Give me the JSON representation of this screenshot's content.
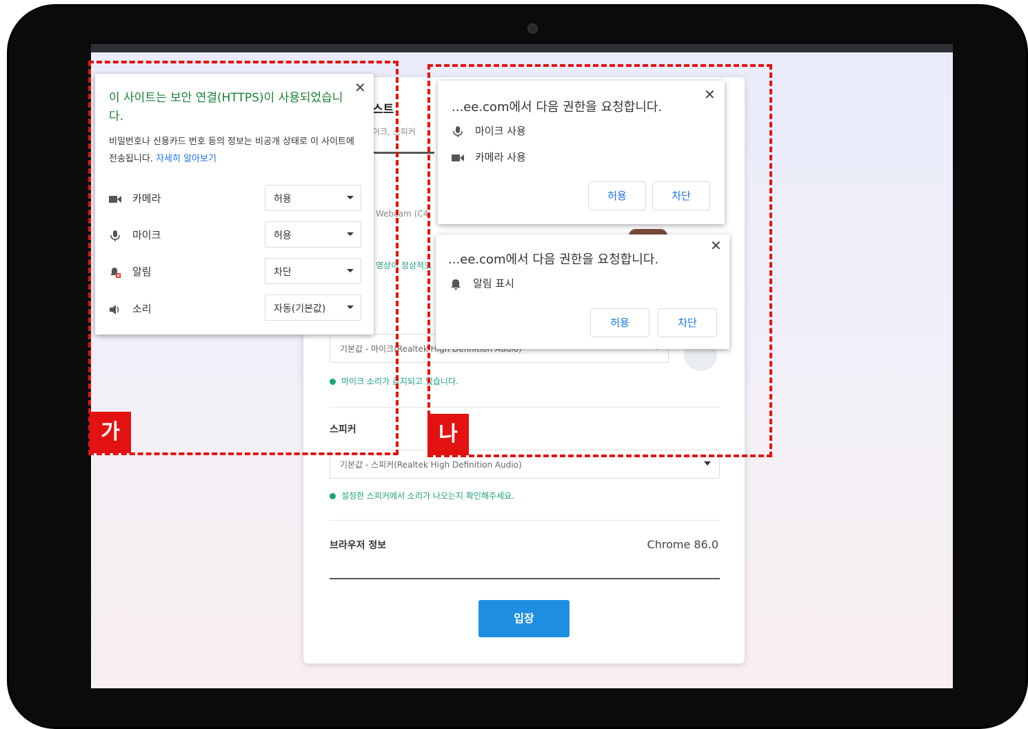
{
  "background_page": {
    "heading_fragment": "스트",
    "sub_fragment": "이크, 스피커",
    "webcam_fragment": "Webcam (C4",
    "video_status_fragment": "영상이 정상적으",
    "mic_select_value": "기본값 - 마이크(Realtek High Definition Audio)",
    "mic_status": "마이크 소리가 감지되고 있습니다.",
    "speaker_label": "스피커",
    "speaker_select_value": "기본값 - 스피커(Realtek High Definition Audio)",
    "speaker_status": "설정한 스피커에서 소리가 나오는지 확인해주세요.",
    "browser_info_label": "브라우저 정보",
    "browser_info_value": "Chrome 86.0",
    "enter_button": "입장"
  },
  "site_info_popup": {
    "title": "이 사이트는 보안 연결(HTTPS)이 사용되었습니다.",
    "description": "비밀번호나 신용카드 번호 등의 정보는 비공개 상태로 이 사이트에 전송됩니다.",
    "learn_more": "자세히 알아보기",
    "permissions": [
      {
        "icon": "camera-icon",
        "label": "카메라",
        "value": "허용"
      },
      {
        "icon": "microphone-icon",
        "label": "마이크",
        "value": "허용"
      },
      {
        "icon": "notification-blocked-icon",
        "label": "알림",
        "value": "차단"
      },
      {
        "icon": "speaker-icon",
        "label": "소리",
        "value": "자동(기본값)"
      }
    ]
  },
  "media_permission_prompt": {
    "title": "...ee.com에서 다음 권한을 요청합니다.",
    "items": [
      {
        "icon": "microphone-icon",
        "label": "마이크 사용"
      },
      {
        "icon": "camera-icon",
        "label": "카메라 사용"
      }
    ],
    "allow_button": "허용",
    "block_button": "차단"
  },
  "notification_permission_prompt": {
    "title": "...ee.com에서 다음 권한을 요청합니다.",
    "items": [
      {
        "icon": "bell-icon",
        "label": "알림 표시"
      }
    ],
    "allow_button": "허용",
    "block_button": "차단"
  },
  "annotations": {
    "left_tag": "가",
    "right_tag": "나"
  },
  "colors": {
    "annotation_red": "#e31212",
    "link_blue": "#1a73e8",
    "title_green": "#188038",
    "enter_blue": "#1e8fe0"
  }
}
